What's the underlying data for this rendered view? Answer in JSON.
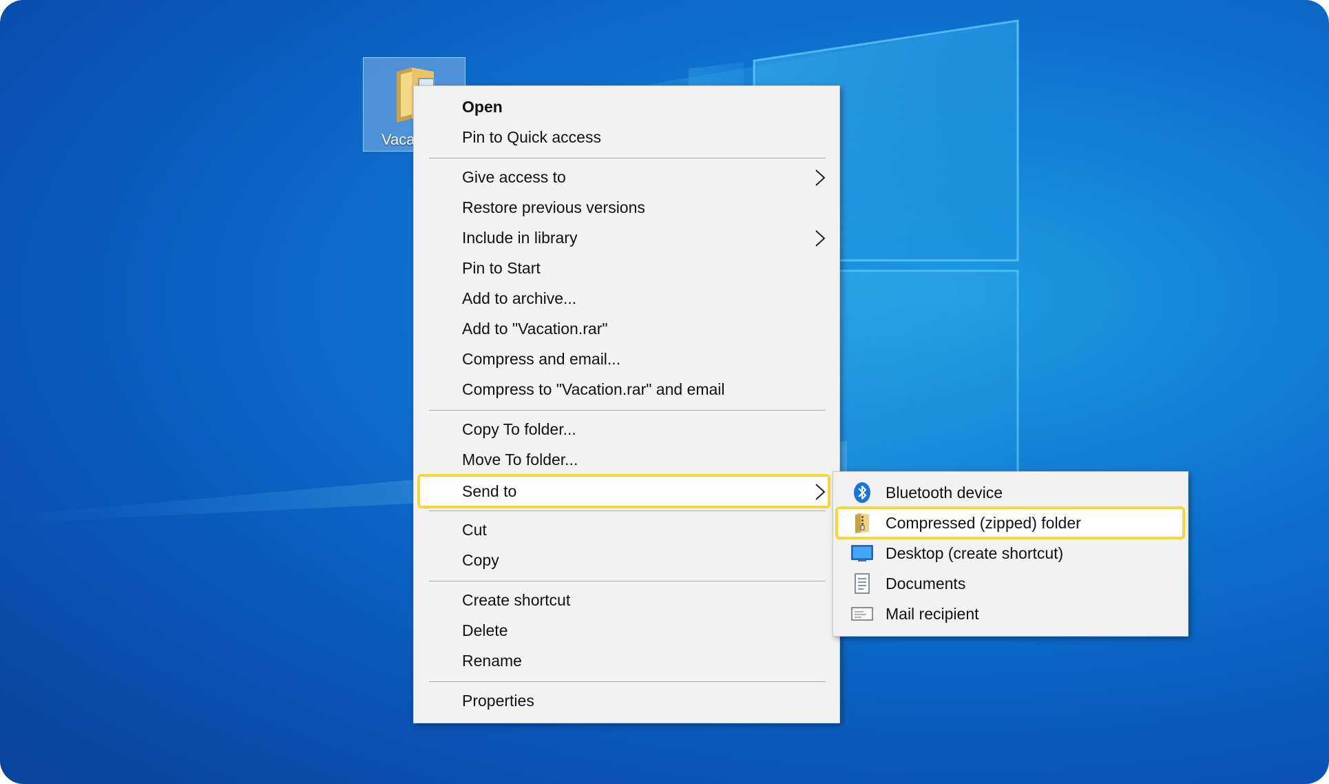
{
  "desktop": {
    "icon_label": "Vaca"
  },
  "context_menu": {
    "groups": [
      [
        {
          "label": "Open",
          "bold": true,
          "submenu": false
        },
        {
          "label": "Pin to Quick access",
          "submenu": false
        }
      ],
      [
        {
          "label": "Give access to",
          "submenu": true
        },
        {
          "label": "Restore previous versions",
          "submenu": false
        },
        {
          "label": "Include in library",
          "submenu": true
        },
        {
          "label": "Pin to Start",
          "submenu": false
        },
        {
          "label": "Add to archive...",
          "submenu": false
        },
        {
          "label": "Add to \"Vacation.rar\"",
          "submenu": false
        },
        {
          "label": "Compress and email...",
          "submenu": false
        },
        {
          "label": "Compress to \"Vacation.rar\" and email",
          "submenu": false
        }
      ],
      [
        {
          "label": "Copy To folder...",
          "submenu": false
        },
        {
          "label": "Move To folder...",
          "submenu": false
        },
        {
          "label": "Send to",
          "submenu": true,
          "highlighted": true
        }
      ],
      [
        {
          "label": "Cut",
          "submenu": false
        },
        {
          "label": "Copy",
          "submenu": false
        }
      ],
      [
        {
          "label": "Create shortcut",
          "submenu": false
        },
        {
          "label": "Delete",
          "submenu": false
        },
        {
          "label": "Rename",
          "submenu": false
        }
      ],
      [
        {
          "label": "Properties",
          "submenu": false
        }
      ]
    ]
  },
  "send_to_menu": {
    "items": [
      {
        "label": "Bluetooth device",
        "icon": "bluetooth-icon"
      },
      {
        "label": "Compressed (zipped) folder",
        "icon": "zip-folder-icon",
        "highlighted": true
      },
      {
        "label": "Desktop (create shortcut)",
        "icon": "desktop-icon"
      },
      {
        "label": "Documents",
        "icon": "documents-icon"
      },
      {
        "label": "Mail recipient",
        "icon": "mail-icon"
      }
    ]
  },
  "colors": {
    "highlight_outline": "#f5d73b",
    "desktop_blue": "#0d72cf",
    "menu_background": "#f2f2f2"
  }
}
